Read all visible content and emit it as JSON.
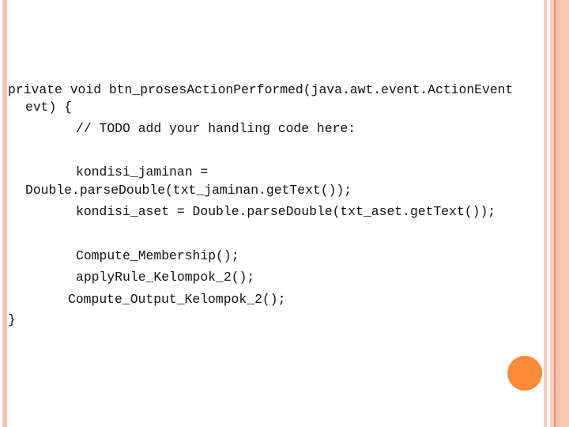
{
  "slide": {
    "code_lines": [
      "private void btn_prosesActionPerformed(java.awt.event.ActionEvent",
      "evt) {",
      "// TODO add your handling code here:",
      "kondisi_jaminan =",
      "Double.parseDouble(txt_jaminan.getText());",
      "kondisi_aset = Double.parseDouble(txt_aset.getText());",
      "Compute_Membership();",
      "applyRule_Kelompok_2();",
      "Compute_Output_Kelompok_2();",
      "}"
    ],
    "colors": {
      "accent_dot": "#fd8a36",
      "stripe": "#f8c4b0",
      "stripe_dark": "#e9956e"
    }
  }
}
